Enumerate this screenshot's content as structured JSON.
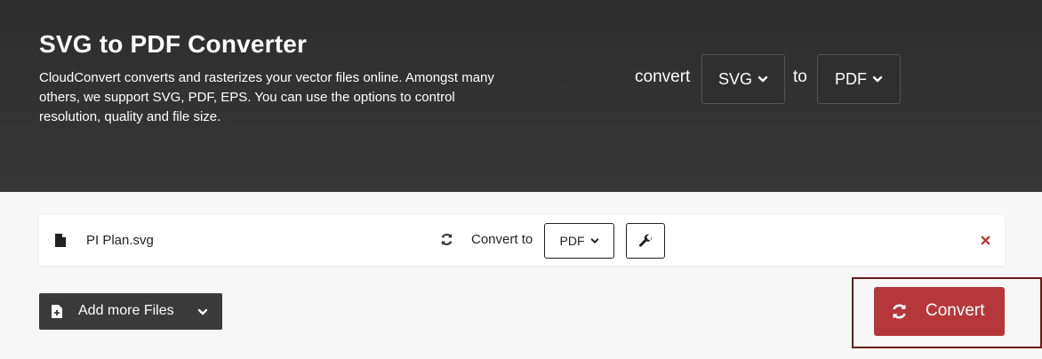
{
  "hero": {
    "title": "SVG to PDF Converter",
    "description": "CloudConvert converts and rasterizes your vector files online. Amongst many others, we support SVG, PDF, EPS. You can use the options to control resolution, quality and file size.",
    "convert_word": "convert",
    "from_format": "SVG",
    "to_word": "to",
    "to_format": "PDF"
  },
  "file_row": {
    "file_name": "PI Plan.svg",
    "convert_to_label": "Convert to",
    "target_format": "PDF"
  },
  "actions": {
    "add_files_label": "Add more Files",
    "convert_label": "Convert"
  },
  "colors": {
    "hero_bg": "#333333",
    "convert_accent": "#b5373a",
    "remove_accent": "#b5373a"
  },
  "icons": {
    "file": "file-icon",
    "refresh": "refresh-icon",
    "wrench": "wrench-icon",
    "remove": "close-icon",
    "add_file": "file-plus-icon",
    "dropdown": "chevron-down-icon"
  }
}
